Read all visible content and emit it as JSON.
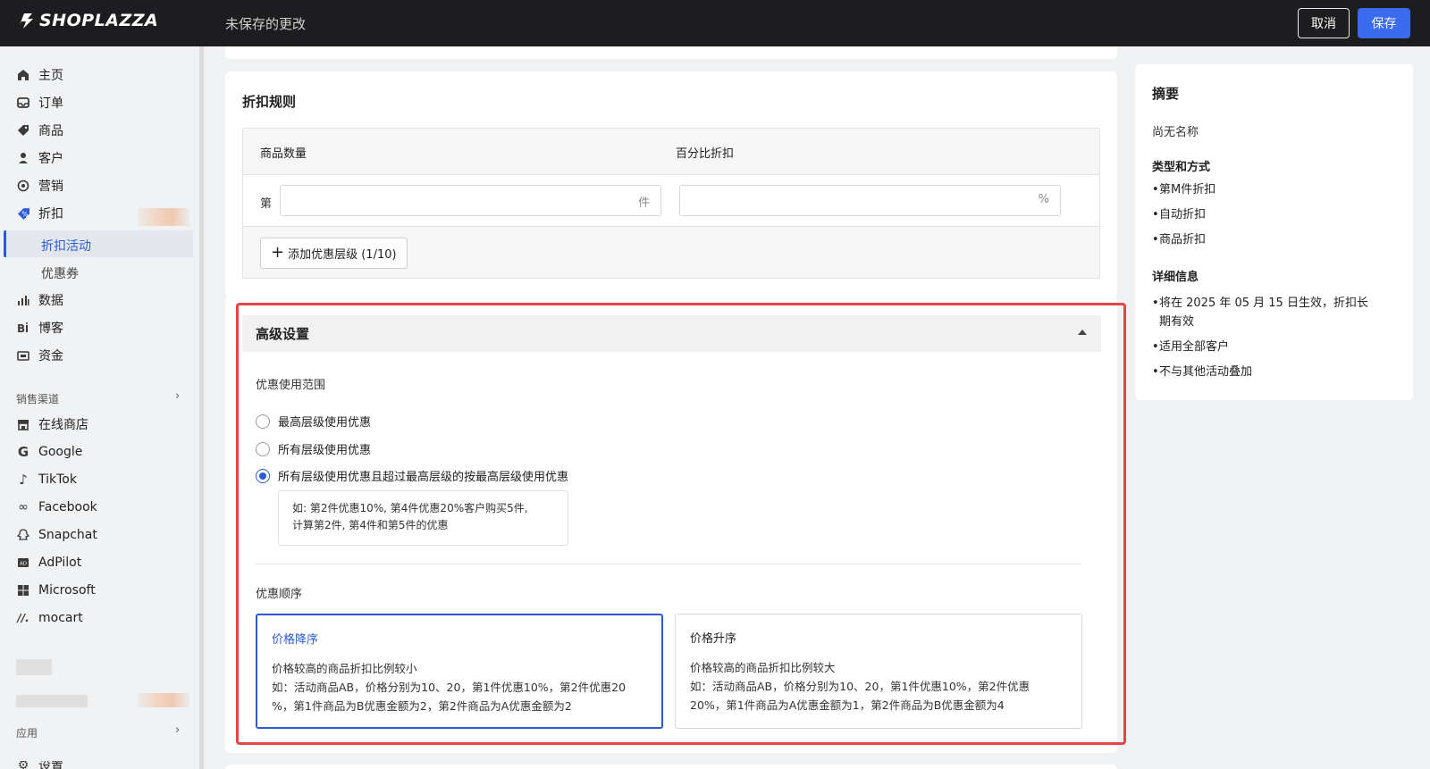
{
  "brand": {
    "logo_text": "SHOPLAZZA"
  },
  "topbar": {
    "unsaved_label": "未保存的更改",
    "cancel_label": "取消",
    "save_label": "保存"
  },
  "sidebar": {
    "items": [
      {
        "label": "主页",
        "icon": "home-icon"
      },
      {
        "label": "订单",
        "icon": "inbox-icon"
      },
      {
        "label": "商品",
        "icon": "tag-icon"
      },
      {
        "label": "客户",
        "icon": "person-icon"
      },
      {
        "label": "营销",
        "icon": "target-icon"
      },
      {
        "label": "折扣",
        "icon": "discount-icon"
      }
    ],
    "sub_items": [
      {
        "label": "折扣活动",
        "active": true
      },
      {
        "label": "优惠券",
        "active": false
      }
    ],
    "items2": [
      {
        "label": "数据",
        "icon": "bar-chart-icon"
      },
      {
        "label": "博客",
        "icon": "blog-icon"
      },
      {
        "label": "资金",
        "icon": "wallet-icon"
      }
    ],
    "sales_channels_label": "销售渠道",
    "channels": [
      {
        "label": "在线商店",
        "icon": "store-icon"
      },
      {
        "label": "Google",
        "icon": "google-icon"
      },
      {
        "label": "TikTok",
        "icon": "tiktok-icon"
      },
      {
        "label": "Facebook",
        "icon": "meta-icon"
      },
      {
        "label": "Snapchat",
        "icon": "snapchat-icon"
      },
      {
        "label": "AdPilot",
        "icon": "adpilot-icon"
      },
      {
        "label": "Microsoft",
        "icon": "microsoft-icon"
      },
      {
        "label": "mocart",
        "icon": "mocart-icon"
      }
    ],
    "apps_label": "应用",
    "settings_label": "设置"
  },
  "rules": {
    "title": "折扣规则",
    "col_quantity": "商品数量",
    "col_percent": "百分比折扣",
    "row_prefix": "第",
    "qty_suffix": "件",
    "pct_suffix": "%",
    "qty_value": "",
    "pct_value": "",
    "add_tier_label": "添加优惠层级 (1/10)"
  },
  "advanced": {
    "title": "高级设置",
    "scope_label": "优惠使用范围",
    "scope_options": [
      {
        "label": "最高层级使用优惠",
        "selected": false
      },
      {
        "label": "所有层级使用优惠",
        "selected": false
      },
      {
        "label": "所有层级使用优惠且超过最高层级的按最高层级使用优惠",
        "selected": true
      }
    ],
    "example_line1": "如: 第2件优惠10%, 第4件优惠20%客户购买5件,",
    "example_line2": "计算第2件, 第4件和第5件的优惠",
    "order_label": "优惠顺序",
    "order_options": [
      {
        "title": "价格降序",
        "selected": true,
        "line1": "价格较高的商品折扣比例较小",
        "line2": "如：活动商品AB，价格分别为10、20，第1件优惠10%，第2件优惠20",
        "line3": "%，第1件商品为B优惠金额为2，第2件商品为A优惠金额为2"
      },
      {
        "title": "价格升序",
        "selected": false,
        "line1": "价格较高的商品折扣比例较大",
        "line2": "如：活动商品AB，价格分别为10、20，第1件优惠10%，第2件优惠",
        "line3": "20%，第1件商品为A优惠金额为1，第2件商品为B优惠金额为4"
      }
    ]
  },
  "summary": {
    "title": "摘要",
    "name": "尚无名称",
    "type_head": "类型和方式",
    "type_items": [
      "第M件折扣",
      "自动折扣",
      "商品折扣"
    ],
    "detail_head": "详细信息",
    "detail_items": [
      "将在 2025 年 05 月 15 日生效，折扣长期有效",
      "适用全部客户",
      "不与其他活动叠加"
    ]
  },
  "colors": {
    "accent": "#3a6bef",
    "highlight_frame": "#e24646",
    "topbar": "#1d1d1f"
  }
}
